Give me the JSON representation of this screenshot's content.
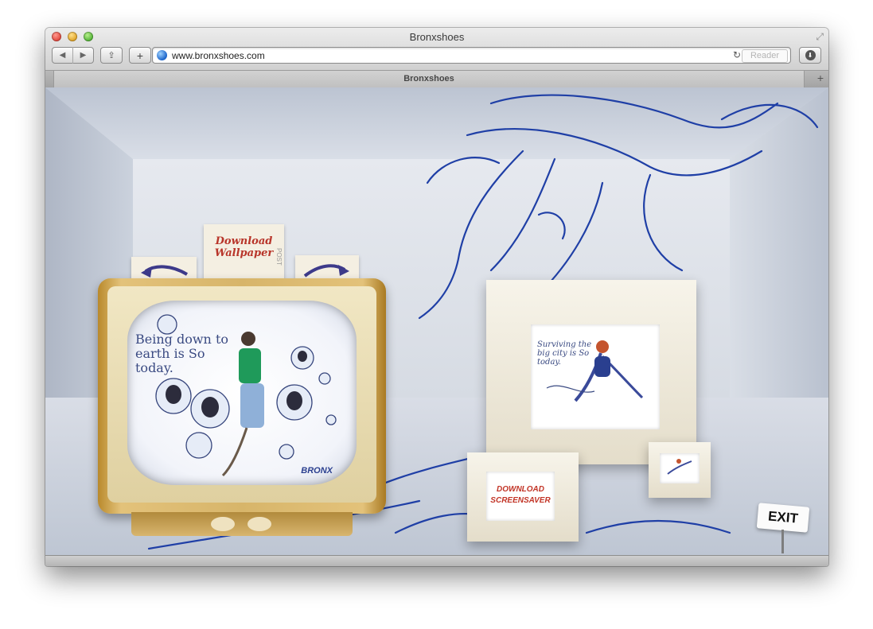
{
  "window": {
    "title": "Bronxshoes"
  },
  "toolbar": {
    "back_label": "◀",
    "forward_label": "▶",
    "share_label": "⇪",
    "add_label": "+",
    "reload_label": "↻",
    "reader_label": "Reader",
    "download_label": "⬇"
  },
  "address": {
    "url": "www.bronxshoes.com"
  },
  "tabs": [
    {
      "label": "Bronxshoes"
    }
  ],
  "page": {
    "wallpaper_card": "Download Wallpaper",
    "wallpaper_card_side": "POST",
    "tv_headline": "Being down to earth is So today.",
    "tv_brand": "BRONX",
    "frame_big_text": "Surviving the big city is So today.",
    "screensaver_card": "DOWNLOAD SCREENSAVER",
    "exit_label": "EXIT"
  }
}
